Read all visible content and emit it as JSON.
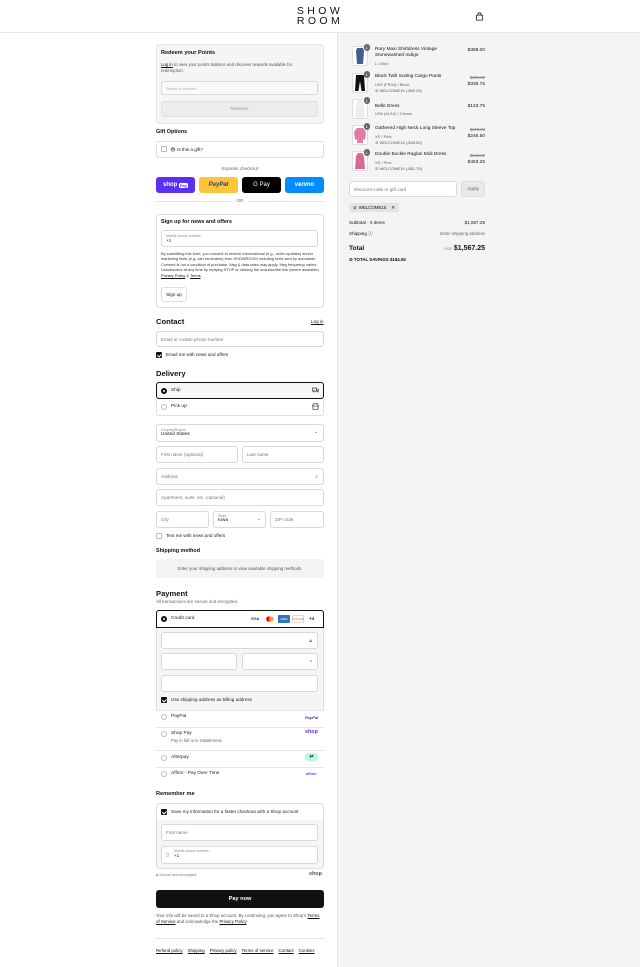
{
  "brand": {
    "line1": "SHOW",
    "line2": "ROOM"
  },
  "points": {
    "title": "Redeem your Points",
    "login_link": "Log in",
    "text": " to view your points balance and discover rewards available for redemption.",
    "select_placeholder": "Select a discount",
    "redeem": "Redeem"
  },
  "gift": {
    "title": "Gift Options",
    "checkbox": "Is this a gift?"
  },
  "express": {
    "label": "Express checkout",
    "shoppay": "shop",
    "shoppay_badge": "Pay",
    "paypal": "PayPal",
    "gpay": "G Pay",
    "venmo": "venmo",
    "or": "OR"
  },
  "signup": {
    "title": "Sign up for news and offers",
    "phone_label": "Mobile phone number",
    "phone_value": "+1",
    "consent": "By submitting this form, you consent to receive informational (e.g., order updates) and/or marketing texts (e.g. cart reminders) from SHOWROOM including texts sent by autodialer. Consent is not a condition of purchase. Msg & data rates may apply. Msg frequency varies. Unsubscribe at any time by replying STOP or clicking the unsubscribe link (where available).",
    "privacy": "Privacy Policy",
    "and": "&",
    "terms": "Terms",
    "button": "Sign up"
  },
  "contact": {
    "title": "Contact",
    "login": "Log in",
    "placeholder": "Email or mobile phone number",
    "email_opt": "Email me with news and offers"
  },
  "delivery": {
    "title": "Delivery",
    "ship": "Ship",
    "pickup": "Pick up",
    "country_label": "Country/Region",
    "country": "United States",
    "first": "First name (optional)",
    "last": "Last name",
    "address": "Address",
    "apt": "Apartment, suite, etc. (optional)",
    "city": "City",
    "state_label": "State",
    "state": "Iowa",
    "zip": "ZIP code",
    "text_opt": "Text me with news and offers"
  },
  "shipping": {
    "title": "Shipping method",
    "msg": "Enter your shipping address to view available shipping methods."
  },
  "payment": {
    "title": "Payment",
    "sub": "All transactions are secure and encrypted.",
    "credit": "Credit card",
    "more": "+4",
    "billing": "Use shipping address as billing address",
    "paypal": "PayPal",
    "shoppay": "Shop Pay",
    "shoppay_sub": "Pay in full or in installments",
    "shoppay_logo": "shop",
    "afterpay": "Afterpay",
    "affirm": "Affirm - Pay Over Time",
    "affirm_logo": "affirm"
  },
  "remember": {
    "title": "Remember me",
    "save": "Save my information for a faster checkout with a Shop account",
    "first": "First name",
    "phone_label": "Mobile phone number",
    "phone": "+1",
    "secure": "Secure and encrypted",
    "shop": "shop"
  },
  "pay_now": "Pay now",
  "disclaimer": {
    "text": "Your info will be saved to a Shop account. By continuing, you agree to Shop's",
    "tos": "Terms of Service",
    "and": "and acknowledge the",
    "privacy": "Privacy Policy"
  },
  "footer": [
    "Refund policy",
    "Shipping",
    "Privacy policy",
    "Terms of service",
    "Contact",
    "Cookies"
  ],
  "cart": {
    "items": [
      {
        "qty": "1",
        "name": "Rory Maxi Shirtdress Vintage Stonewashed Indigo",
        "variant": "L / Blue",
        "price": "$388.00",
        "original": "",
        "discount": ""
      },
      {
        "qty": "1",
        "name": "Black Twill Suiting Cargo Pants",
        "variant": "US2 (FR34) / Black",
        "price": "$335.75",
        "original": "$395.00",
        "discount": "WELCOME15 (-$59.25)"
      },
      {
        "qty": "1",
        "name": "Belle Dress",
        "variant": "US8 (AU10) / Cream",
        "price": "$123.75",
        "original": "",
        "discount": ""
      },
      {
        "qty": "1",
        "name": "Gathered High Neck Long Sleeve Top",
        "variant": "XS / Pink",
        "price": "$246.50",
        "original": "$290.00",
        "discount": "WELCOME15 (-$43.50)"
      },
      {
        "qty": "1",
        "name": "Double Buckle Raglan Midi Dress",
        "variant": "XS / Pink",
        "price": "$463.25",
        "original": "$545.00",
        "discount": "WELCOME15 (-$81.75)"
      }
    ],
    "code_placeholder": "Discount code or gift card",
    "apply": "Apply",
    "code": "WELCOME15",
    "subtotal_label": "Subtotal · 5 items",
    "subtotal": "$1,567.25",
    "shipping_label": "Shipping",
    "shipping": "Enter shipping address",
    "total_label": "Total",
    "currency": "USD",
    "total": "$1,567.25",
    "savings_label": "TOTAL SAVINGS",
    "savings": "$184.50"
  },
  "colors": {
    "shoppay": "#5a31f4",
    "paypal": "#ffc439",
    "gpay": "#000000",
    "venmo": "#008cff",
    "dark": "#111111"
  }
}
